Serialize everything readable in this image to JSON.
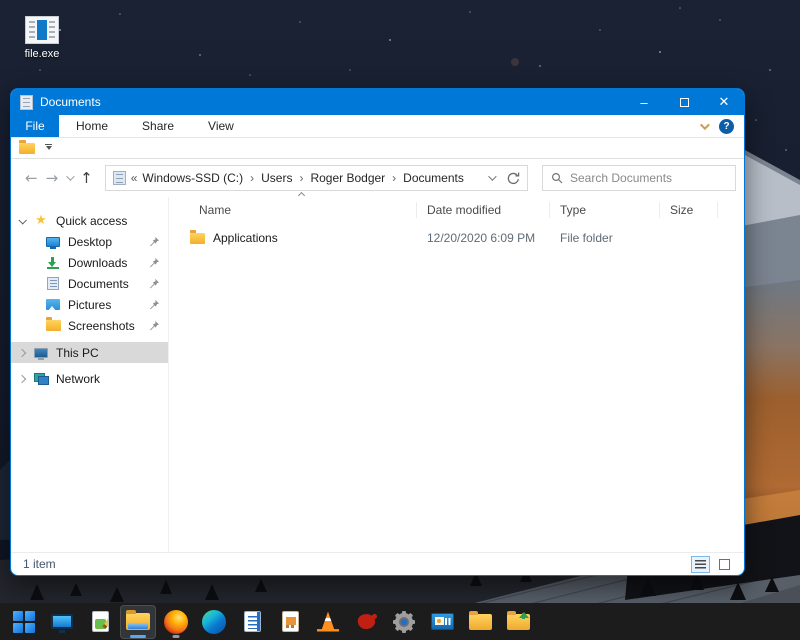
{
  "desktop": {
    "icon_label": "file.exe"
  },
  "window": {
    "title": "Documents",
    "controls": {
      "minimize": "–",
      "close": "✕"
    }
  },
  "menu": {
    "items": [
      "File",
      "Home",
      "Share",
      "View"
    ]
  },
  "nav": {
    "icons": {
      "back": "←",
      "forward": "→",
      "up": "↑"
    },
    "breadcrumb": {
      "prefix": "«",
      "separator": "›",
      "segments": [
        "Windows-SSD (C:)",
        "Users",
        "Roger Bodger",
        "Documents"
      ]
    },
    "search_placeholder": "Search Documents"
  },
  "sidebar": {
    "items": [
      {
        "label": "Quick access",
        "icon": "star-icon"
      },
      {
        "label": "Desktop",
        "icon": "monitor-icon",
        "pinned": true
      },
      {
        "label": "Downloads",
        "icon": "download-icon",
        "pinned": true
      },
      {
        "label": "Documents",
        "icon": "document-icon",
        "pinned": true
      },
      {
        "label": "Pictures",
        "icon": "picture-icon",
        "pinned": true
      },
      {
        "label": "Screenshots",
        "icon": "folder-icon",
        "pinned": true
      },
      {
        "label": "This PC",
        "icon": "computer-icon",
        "selected": true
      },
      {
        "label": "Network",
        "icon": "network-icon"
      }
    ]
  },
  "main": {
    "columns": [
      "Name",
      "Date modified",
      "Type",
      "Size"
    ],
    "rows": [
      {
        "name": "Applications",
        "date_modified": "12/20/2020 6:09 PM",
        "type": "File folder",
        "size": ""
      }
    ]
  },
  "statusbar": {
    "items_count": "1 item"
  },
  "taskbar": {
    "items": [
      "start",
      "monitor-app",
      "editor-app",
      "file-explorer",
      "firefox",
      "edge",
      "document-app",
      "presentation-app",
      "vlc",
      "red-app",
      "settings",
      "control-panel-app",
      "folder",
      "folder-upload"
    ],
    "active_item": "file-explorer",
    "running_items": [
      "file-explorer",
      "firefox"
    ]
  },
  "colors": {
    "accent": "#0078d7",
    "titlebar": "#0078d7",
    "sidebar_selection": "#d9d9d9",
    "taskbar_background": "#1c1c1c",
    "folder_yellow": "#f3ae2b"
  }
}
